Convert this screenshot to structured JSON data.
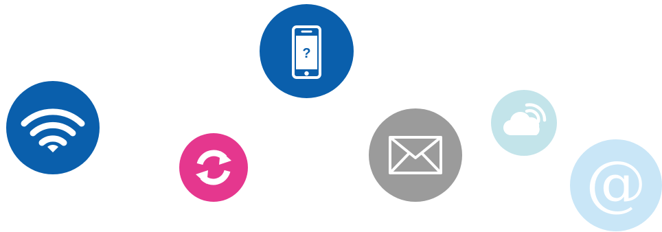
{
  "icons": [
    {
      "name": "wifi-icon",
      "color": "#0a5fac"
    },
    {
      "name": "sync-icon",
      "color": "#e5378e"
    },
    {
      "name": "smartphone-question-icon",
      "color": "#0a5fac"
    },
    {
      "name": "mail-envelope-icon",
      "color": "#9b9b9b"
    },
    {
      "name": "cloud-signal-icon",
      "color": "#c3e4ea"
    },
    {
      "name": "at-sign-icon",
      "color": "#c9e6f7"
    }
  ],
  "phone": {
    "question_mark": "?"
  },
  "at": {
    "symbol": "@"
  }
}
